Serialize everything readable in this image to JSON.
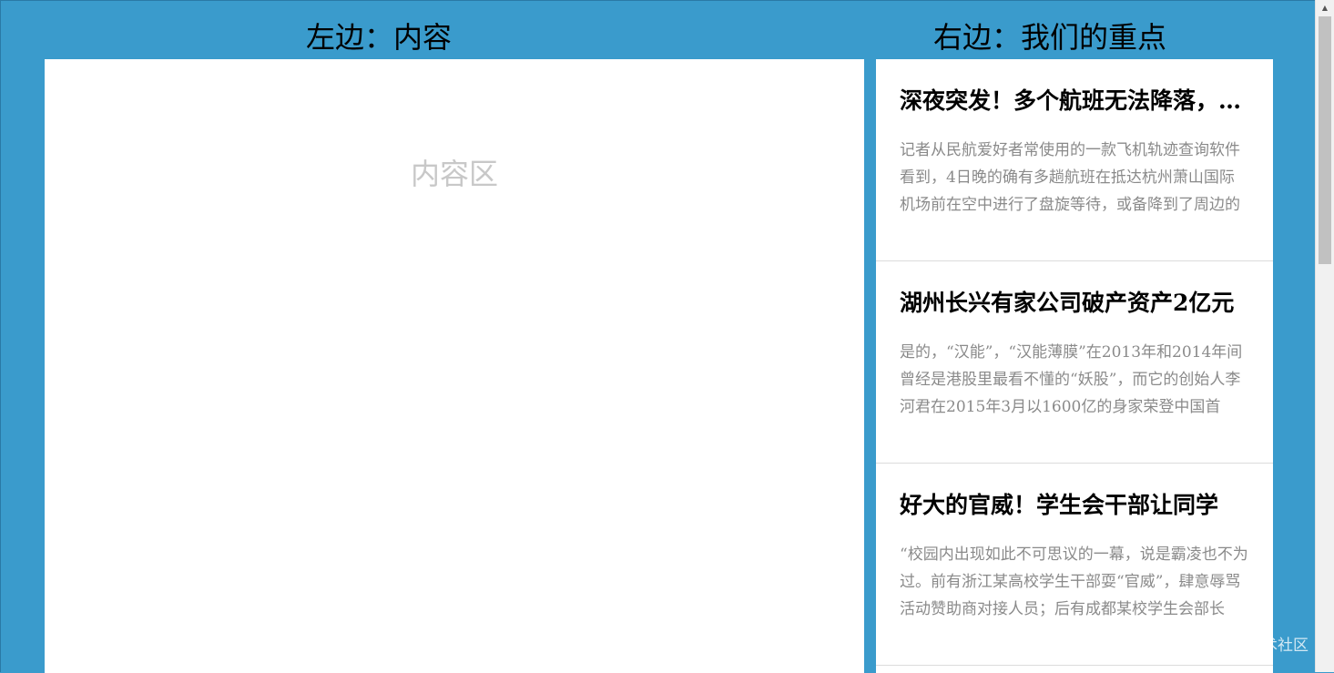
{
  "headings": {
    "left": "左边：内容",
    "right": "右边：我们的重点"
  },
  "content": {
    "placeholder": "内容区"
  },
  "news": [
    {
      "title": "深夜突发！多个航班无法降落，杭州萧山国际机场",
      "summary": "记者从民航爱好者常使用的一款飞机轨迹查询软件看到，4日晚的确有多趟航班在抵达杭州萧山国际机场前在空中进行了盘旋等待，或备降到了周边的"
    },
    {
      "title": "湖州长兴有家公司破产资产2亿元",
      "summary": "是的，“汉能”，“汉能薄膜”在2013年和2014年间曾经是港股里最看不懂的“妖股”，而它的创始人李河君在2015年3月以1600亿的身家荣登中国首富，不"
    },
    {
      "title": "好大的官威！学生会干部让同学",
      "summary": "“校园内出现如此不可思议的一幕，说是霸凌也不为过。前有浙江某高校学生干部耍“官威”，肆意辱骂活动赞助商对接人员；后有成都某校学生会部长"
    }
  ],
  "watermark": "@稀土掘金技术社区",
  "colors": {
    "background": "#3a9bcc",
    "panel": "#ffffff",
    "placeholder": "#c8c8c8",
    "summary": "#8a8a8a"
  },
  "icons": {
    "scroll_up": "triangle-up"
  }
}
